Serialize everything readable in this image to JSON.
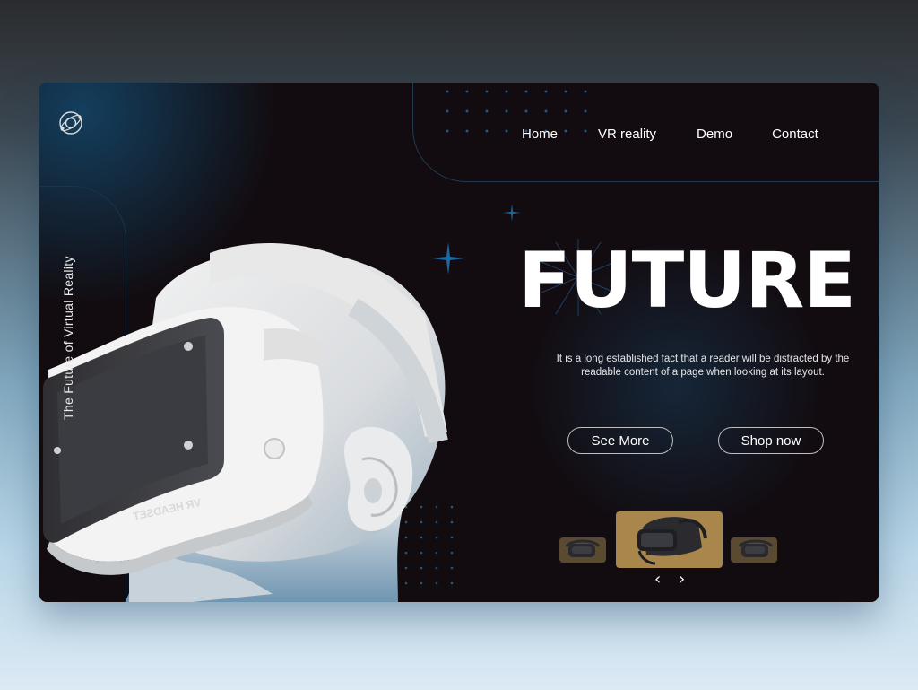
{
  "brand": {
    "logo_icon": "orbit-logo-icon"
  },
  "nav": {
    "items": [
      {
        "label": "Home"
      },
      {
        "label": "VR reality"
      },
      {
        "label": "Demo"
      },
      {
        "label": "Contact"
      }
    ]
  },
  "hero": {
    "vertical_caption": "The Future of Virtual Reality",
    "headline": "FUTURE",
    "description": "It is a long established fact that a reader will be distracted by the readable content of a page when looking at its layout.",
    "headset_label": "VR HEADSET"
  },
  "buttons": {
    "see_more": "See More",
    "shop_now": "Shop now"
  },
  "carousel": {
    "prev_label": "‹",
    "next_label": "›",
    "items": [
      {
        "name": "headset-thumb-left"
      },
      {
        "name": "headset-thumb-center",
        "active": true
      },
      {
        "name": "headset-thumb-right"
      }
    ]
  },
  "colors": {
    "card_bg": "#120b0f",
    "accent_blue": "#1c5a85",
    "thumb_gold": "#a9874c",
    "text": "#ffffff"
  }
}
